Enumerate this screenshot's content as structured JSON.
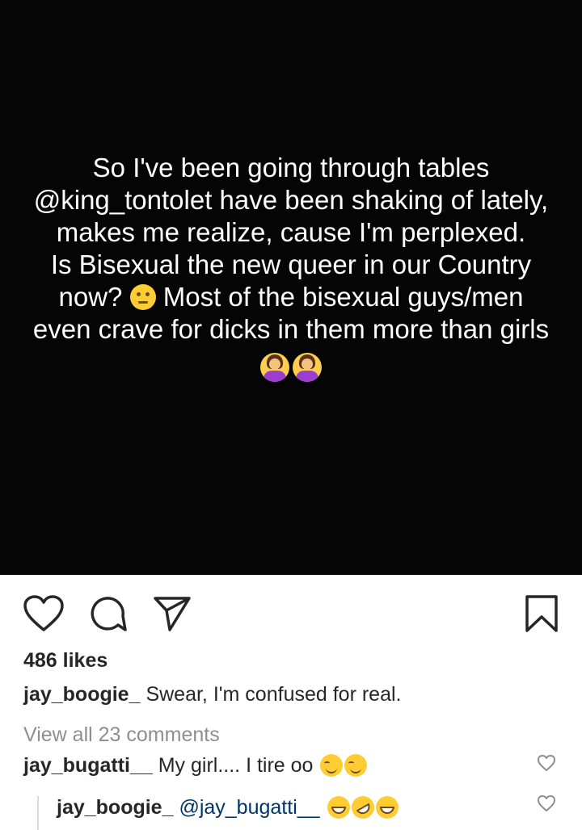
{
  "post": {
    "text_lines": "So I've been going through tables\n@king_tontolet have been shaking of lately,\nmakes me realize, cause I'm perplexed.\nIs Bisexual the new queer in our Country",
    "line5_start": "now? ",
    "line5_end": " Most of the bisexual guys/men",
    "line6": "even crave for dicks in them more than girls",
    "emojis": [
      "thinking-face",
      "person-tipping-hand",
      "person-shrugging"
    ]
  },
  "actions": {
    "icons": [
      "heart-icon",
      "comment-icon",
      "share-icon",
      "bookmark-icon"
    ]
  },
  "likes_text": "486 likes",
  "caption": {
    "username": "jay_boogie_",
    "text": " Swear, I'm confused for real."
  },
  "view_all": "View all 23 comments",
  "comment": {
    "username": "jay_bugatti__",
    "text": " My girl.... I tire oo "
  },
  "reply": {
    "username": "jay_boogie_",
    "mention": " @jay_bugatti__ "
  },
  "colors": {
    "image_bg": "#050505",
    "text": "#262626",
    "muted": "#8e8e8e",
    "mention": "#003569"
  }
}
